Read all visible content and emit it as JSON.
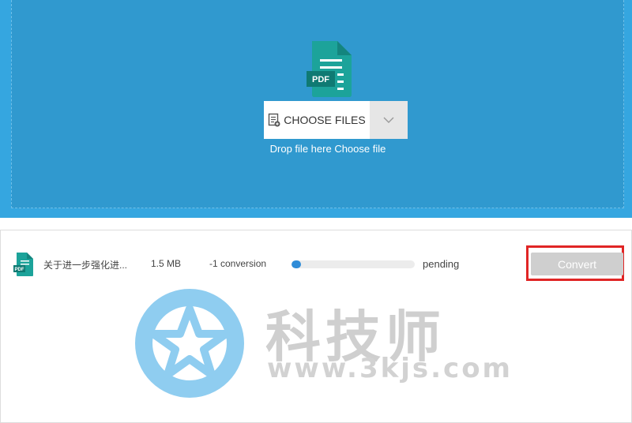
{
  "upload": {
    "file_badge": "PDF",
    "choose_label": "CHOOSE FILES",
    "drop_text": "Drop file here",
    "choose_link": "Choose file"
  },
  "files": [
    {
      "badge": "PDF",
      "name": "关于进一步强化进...",
      "size": "1.5 MB",
      "conversions": "-1 conversion",
      "progress_percent": 5,
      "status": "pending",
      "action_label": "Convert"
    }
  ],
  "watermark": {
    "title": "科技师",
    "url": "www.3kjs.com"
  },
  "colors": {
    "upload_bg": "#35a6e0",
    "drop_bg": "#3099cf",
    "pdf_icon": "#1ca39a",
    "progress": "#2f8cd8",
    "highlight": "#e02525",
    "convert_disabled": "#cfcfcf"
  },
  "icons": {
    "big_file": "pdf-file-icon",
    "choose": "file-add-icon",
    "dropdown": "chevron-down-icon",
    "row_file": "pdf-file-icon",
    "watermark_logo": "star-logo-icon"
  }
}
